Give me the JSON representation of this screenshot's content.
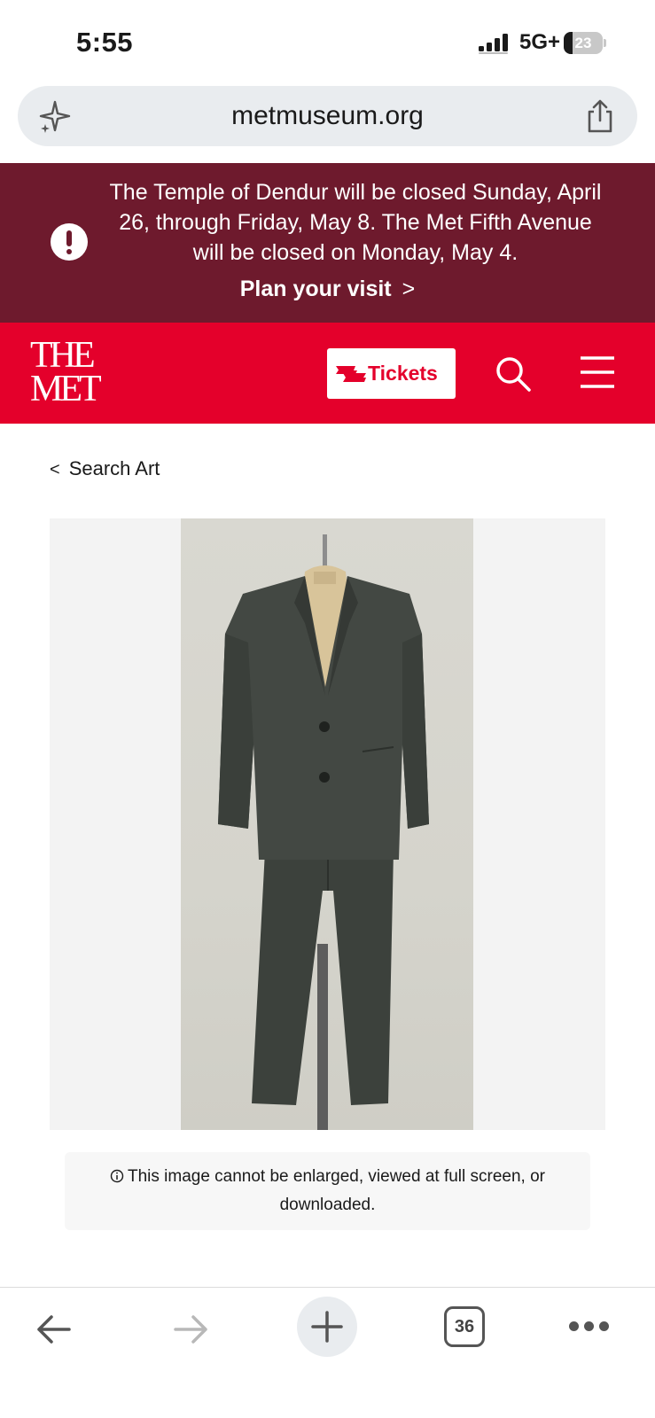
{
  "status_bar": {
    "time": "5:55",
    "network": "5G+",
    "battery": "23",
    "battery_percent": 23
  },
  "browser": {
    "url": "metmuseum.org",
    "sparkle_icon": "sparkle-icon",
    "share_icon": "share-icon"
  },
  "alert": {
    "message": "The Temple of Dendur will be closed Sunday, April 26, through Friday, May 8. The Met Fifth Avenue will be closed on Monday, May 4.",
    "link_label": "Plan your visit",
    "background_color": "#6e1a2d"
  },
  "header": {
    "logo_line1": "THE",
    "logo_line2": "MET",
    "tickets_label": "Tickets",
    "brand_color": "#e4002b"
  },
  "breadcrumb": {
    "label": "Search Art"
  },
  "notice": {
    "text": "This image cannot be enlarged, viewed at full screen, or downloaded."
  },
  "toolbar": {
    "tab_count": "36"
  }
}
